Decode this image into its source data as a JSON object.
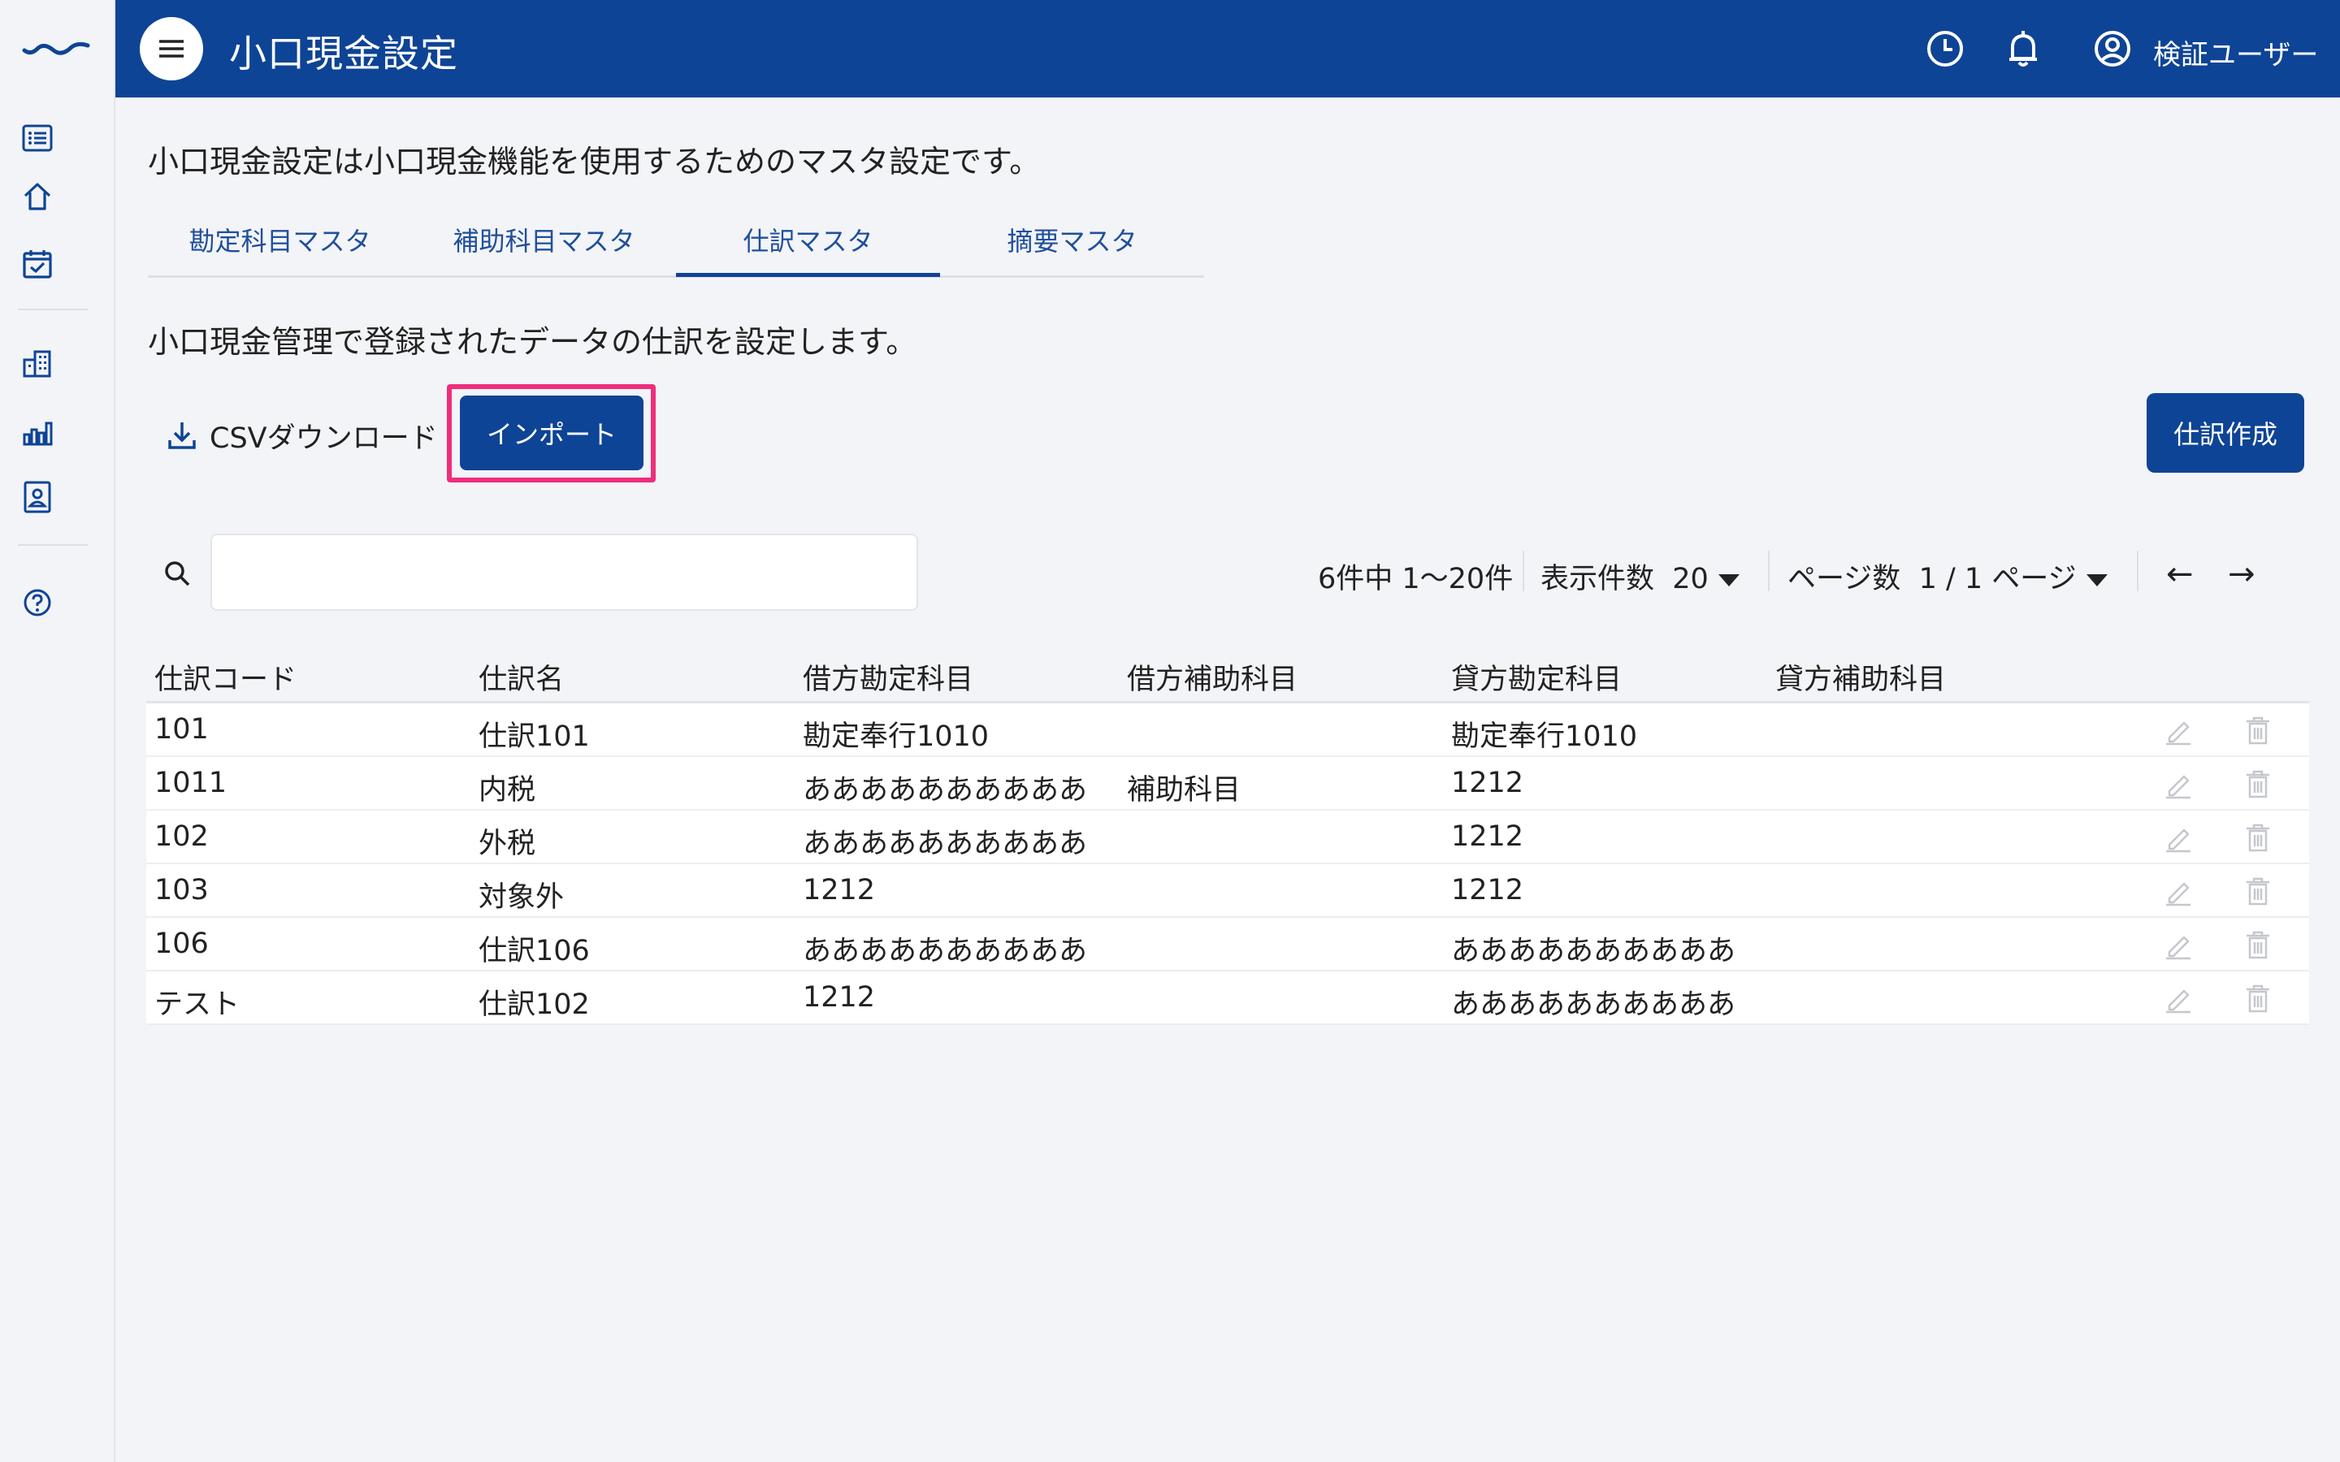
{
  "header": {
    "title": "小口現金設定",
    "user_name": "検証ユーザー"
  },
  "description": "小口現金設定は小口現金機能を使用するためのマスタ設定です。",
  "tabs": [
    {
      "label": "勘定科目マスタ",
      "active": false
    },
    {
      "label": "補助科目マスタ",
      "active": false
    },
    {
      "label": "仕訳マスタ",
      "active": true
    },
    {
      "label": "摘要マスタ",
      "active": false
    }
  ],
  "sub_description": "小口現金管理で登録されたデータの仕訳を設定します。",
  "toolbar": {
    "csv_label": "CSVダウンロード",
    "import_label": "インポート",
    "create_label": "仕訳作成"
  },
  "search": {
    "value": "",
    "placeholder": ""
  },
  "pagination": {
    "summary": "6件中 1〜20件",
    "per_page_label": "表示件数",
    "per_page_value": "20",
    "page_label": "ページ数",
    "page_value": "1 / 1 ページ",
    "prev": "←",
    "next": "→"
  },
  "table": {
    "headers": [
      "仕訳コード",
      "仕訳名",
      "借方勘定科目",
      "借方補助科目",
      "貸方勘定科目",
      "貸方補助科目"
    ],
    "rows": [
      [
        "101",
        "仕訳101",
        "勘定奉行1010",
        "",
        "勘定奉行1010",
        ""
      ],
      [
        "1011",
        "内税",
        "ああああああああああ",
        "補助科目",
        "1212",
        ""
      ],
      [
        "102",
        "外税",
        "ああああああああああ",
        "",
        "1212",
        ""
      ],
      [
        "103",
        "対象外",
        "1212",
        "",
        "1212",
        ""
      ],
      [
        "106",
        "仕訳106",
        "ああああああああああ",
        "",
        "ああああああああああ",
        ""
      ],
      [
        "テスト",
        "仕訳102",
        "1212",
        "",
        "ああああああああああ",
        ""
      ]
    ]
  },
  "colors": {
    "primary": "#0e4495",
    "highlight": "#ef2e7b",
    "background": "#f3f4f7",
    "icon_muted": "#c4c7cc"
  },
  "icons": {
    "logo": "wave-logo",
    "sidebar": [
      "list-icon",
      "home-icon",
      "calendar-check-icon",
      "building-icon",
      "bar-chart-icon",
      "id-badge-icon",
      "help-circle-icon"
    ],
    "header": [
      "menu-icon",
      "clock-icon",
      "bell-icon",
      "user-circle-icon"
    ],
    "row_actions": [
      "edit-icon",
      "delete-icon"
    ]
  }
}
